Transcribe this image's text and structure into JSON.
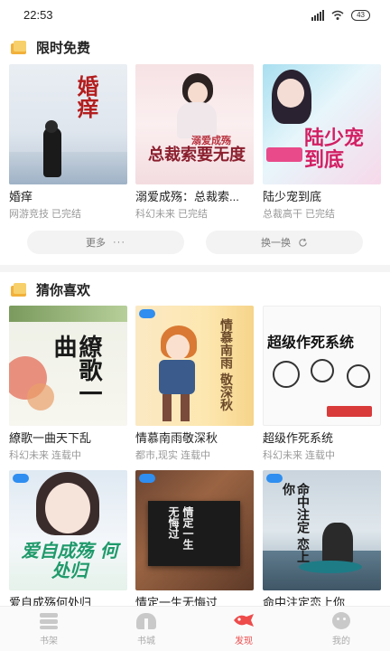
{
  "status": {
    "time": "22:53",
    "battery": "43"
  },
  "sections": {
    "free": {
      "title": "限时免费",
      "books": [
        {
          "name": "婚痒",
          "meta": "网游竞技 已完结",
          "cover_title": "婚痒"
        },
        {
          "name": "溺爱成殇：总裁索...",
          "meta": "科幻未来 已完结",
          "cover_title": "总裁索要无度",
          "cover_sub": "溺爱成殇"
        },
        {
          "name": "陆少宠到底",
          "meta": "总裁高干 已完结",
          "cover_title": "陆少宠到底"
        }
      ],
      "more_label": "更多",
      "more_icon": "ellipsis-icon",
      "refresh_label": "换一换",
      "refresh_icon": "refresh-icon"
    },
    "guess": {
      "title": "猜你喜欢",
      "books": [
        {
          "name": "繚歌一曲天下乱",
          "meta": "科幻未来 连载中",
          "cover_title": "繚歌一曲"
        },
        {
          "name": "情慕南雨敬深秋",
          "meta": "都市,现实 连载中",
          "cover_title": "情慕南雨 敬深秋"
        },
        {
          "name": "超级作死系统",
          "meta": "科幻未来 连载中",
          "cover_title": "超级作死系统"
        },
        {
          "name": "爱自成殇何处归",
          "meta": "",
          "cover_title": "爱自成殇 何处归"
        },
        {
          "name": "情定一生无悔过",
          "meta": "",
          "cover_title": "情定一生 无悔过"
        },
        {
          "name": "命中注定恋上你",
          "meta": "",
          "cover_title": "命中注定 恋上你"
        }
      ]
    }
  },
  "tabs": [
    {
      "label": "书架",
      "icon": "bookshelf-icon",
      "active": false
    },
    {
      "label": "书城",
      "icon": "bookstore-icon",
      "active": false
    },
    {
      "label": "发现",
      "icon": "discover-icon",
      "active": true
    },
    {
      "label": "我的",
      "icon": "profile-icon",
      "active": false
    }
  ],
  "colors": {
    "accent": "#ee4b4b",
    "section_icon": "#f2b13b",
    "meta_text": "#999999"
  }
}
